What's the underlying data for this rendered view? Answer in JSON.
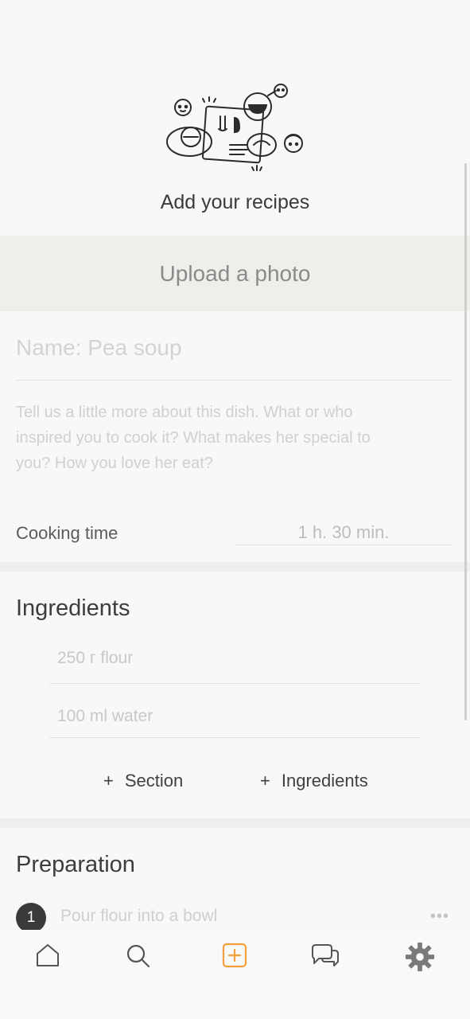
{
  "hero": {
    "title": "Add your recipes"
  },
  "upload": {
    "label": "Upload a photo"
  },
  "details": {
    "name_placeholder": "Name: Pea soup",
    "description_placeholder": "Tell us a little more about this dish. What or who inspired you to cook it? What makes her special to you? How you love her eat?",
    "cooking_time_label": "Cooking time",
    "cooking_time_value": "1 h. 30 min."
  },
  "ingredients": {
    "title": "Ingredients",
    "items": [
      "250 г flour",
      "100 ml water"
    ],
    "add_section_label": "Section",
    "add_ingredients_label": "Ingredients",
    "plus": "+"
  },
  "preparation": {
    "title": "Preparation",
    "steps": [
      {
        "number": "1",
        "text": "Pour flour into a bowl"
      }
    ],
    "more": "•••"
  },
  "nav": {
    "items": [
      {
        "icon": "home-icon"
      },
      {
        "icon": "search-icon"
      },
      {
        "icon": "add-recipe-icon",
        "active": true
      },
      {
        "icon": "chat-icon"
      },
      {
        "icon": "gear-icon"
      }
    ],
    "accent": "#f5a03a"
  },
  "colors": {
    "background": "#f7f7f6",
    "upload_band": "#efeeeb",
    "step_badge": "#3a3a3a"
  }
}
